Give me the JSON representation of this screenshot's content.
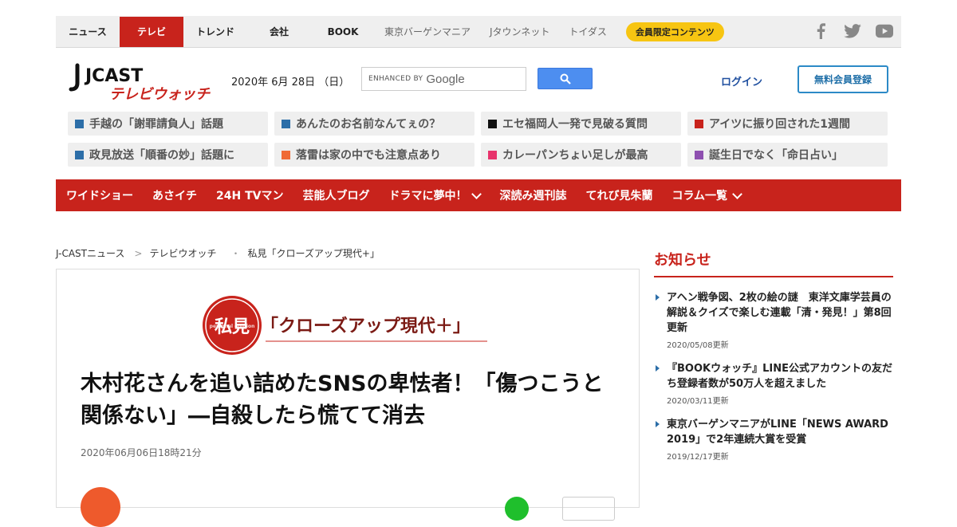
{
  "topnav": {
    "items": [
      {
        "label": "ニュース",
        "active": false
      },
      {
        "label": "テレビ",
        "active": true
      },
      {
        "label": "トレンド",
        "active": false
      },
      {
        "label": "会社",
        "active": false
      },
      {
        "label": "BOOK",
        "active": false
      }
    ],
    "sub_items": [
      "東京バーゲンマニア",
      "Jタウンネット",
      "トイダス"
    ],
    "member_label": "会員限定コンテンツ",
    "social_icons": [
      "facebook-icon",
      "twitter-icon",
      "youtube-icon"
    ]
  },
  "header": {
    "logo_main": "JCAST",
    "logo_sub": "テレビウォッチ",
    "date": "2020年 6月 28日 （日）",
    "search": {
      "enhanced_by": "ENHANCED BY",
      "brand": "Google"
    },
    "login_label": "ログイン",
    "register_label": "無料会員登録"
  },
  "topics": [
    {
      "label": "手越の「謝罪請負人」話題",
      "color": "#2c6ea8"
    },
    {
      "label": "あんたのお名前なんてぇの？",
      "color": "#2c6ea8"
    },
    {
      "label": "エセ福岡人一発で見破る質問",
      "color": "#111111"
    },
    {
      "label": "アイツに振り回された1週間",
      "color": "#c8231c"
    },
    {
      "label": "政見放送「順番の妙」話題に",
      "color": "#2c6ea8"
    },
    {
      "label": "落雷は家の中でも注意点あり",
      "color": "#f06a35"
    },
    {
      "label": "カレーパンちょい足しが最高",
      "color": "#e8336c"
    },
    {
      "label": "誕生日でなく「命日占い」",
      "color": "#8e4fb0"
    }
  ],
  "rednav": {
    "items": [
      {
        "label": "ワイドショー",
        "dropdown": false
      },
      {
        "label": "あさイチ",
        "dropdown": false
      },
      {
        "label": "24H TVマン",
        "dropdown": false
      },
      {
        "label": "芸能人ブログ",
        "dropdown": false
      },
      {
        "label": "ドラマに夢中！",
        "dropdown": true
      },
      {
        "label": "深読み週刊誌",
        "dropdown": false
      },
      {
        "label": "てれび見朱蘭",
        "dropdown": false
      },
      {
        "label": "コラム一覧",
        "dropdown": true
      }
    ]
  },
  "breadcrumb": [
    "J-CASTニュース",
    "テレビウオッチ",
    "私見「クローズアップ現代+」"
  ],
  "article": {
    "banner_seal_text": "私見",
    "banner_seal_sub": "personal opinion",
    "banner_title": "「クローズアップ現代＋」",
    "title": "木村花さんを追い詰めたSNSの卑怯者！「傷つこうと関係ない」―自殺したら慌てて消去",
    "published": "2020年06月06日18時21分"
  },
  "sidebar": {
    "heading": "お知らせ",
    "news": [
      {
        "title": "アヘン戦争図、2枚の絵の謎　東洋文庫学芸員の解説＆クイズで楽しむ連載「清・発見！」第8回更新",
        "date": "2020/05/08更新"
      },
      {
        "title": "『BOOKウォッチ』LINE公式アカウントの友だち登録者数が50万人を超えました",
        "date": "2020/03/11更新"
      },
      {
        "title": "東京バーゲンマニアがLINE「NEWS AWARD 2019」で2年連続大賞を受賞",
        "date": "2019/12/17更新"
      }
    ]
  },
  "colors": {
    "brand_red": "#c8231c",
    "link_blue": "#1f4f9f",
    "member_yellow": "#f7c512"
  }
}
